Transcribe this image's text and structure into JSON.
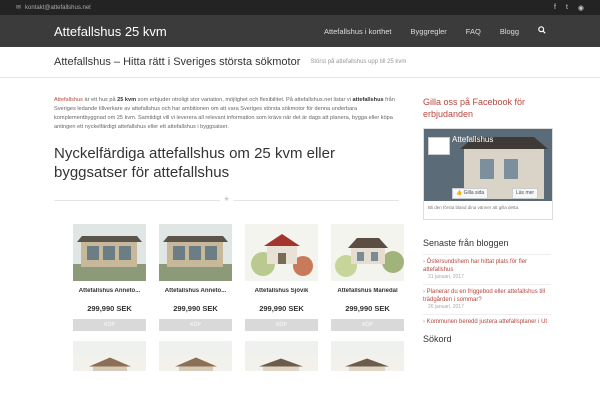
{
  "topbar": {
    "email": "kontakt@attefallshus.net",
    "social_icons": [
      "facebook-icon",
      "twitter-icon",
      "rss-icon"
    ]
  },
  "header": {
    "logo": "Attefallshus 25 kvm",
    "nav": [
      "Attefallshus i korthet",
      "Byggregler",
      "FAQ",
      "Blogg"
    ]
  },
  "titlebar": {
    "title": "Attefallshus – Hitta rätt i Sveriges största sökmotor",
    "subtitle": "Störst på attefallshus upp till 25 kvm"
  },
  "intro": {
    "p1_link": "Attefallshus",
    "p1_a": " är ett hus på ",
    "p1_bold": "25 kvm",
    "p1_b": " som erbjuder otroligt stor variation, möjlighet och flexibilitet. På attefallshus.net listar vi ",
    "p1_bold2": "attefallshus",
    "p1_c": " från Sveriges ledande tillverkare av attefallshus och har ambitionen om att vara Sveriges största sökmotor för denna underbara komplementbyggnad om 25 kvm. Samtidigt vill vi leverera all relevant information som krävs när det är dags att planera, bygga eller köpa antingen ett nyckelfärdigt attefallshus eller ett attefallshus i byggsatser."
  },
  "section_title": "Nyckelfärdiga attefallshus om 25 kvm eller byggsatser för attefallshus",
  "products": [
    {
      "name": "Attefallshus Anneto...",
      "price": "299,990 SEK",
      "buy": "KÖP"
    },
    {
      "name": "Attefallshus Anneto...",
      "price": "299,990 SEK",
      "buy": "KÖP"
    },
    {
      "name": "Attefallshus Sjövik",
      "price": "299,990 SEK",
      "buy": "KÖP"
    },
    {
      "name": "Attefallshus Mariedal",
      "price": "299,990 SEK",
      "buy": "KÖP"
    }
  ],
  "sidebar": {
    "fb_heading": "Gilla oss på Facebook för erbjudanden",
    "fb_page_name": "Attefallshus",
    "fb_like": "Gilla sida",
    "fb_more": "Läs mer",
    "fb_foot": "Bli den första bland dina vänner att gilla detta.",
    "blog_heading": "Senaste från bloggen",
    "posts": [
      {
        "title": "Östersundshem har hittat plats för fler attefallshus",
        "date": "31 januari, 2017"
      },
      {
        "title": "Planerar du en friggebod eller attefallshus till trädgården i sommar?",
        "date": "26 januari, 2017"
      },
      {
        "title": "Kommunen beredd justera attefallsplaner i Ut",
        "date": ""
      }
    ],
    "search_heading": "Sökord"
  }
}
